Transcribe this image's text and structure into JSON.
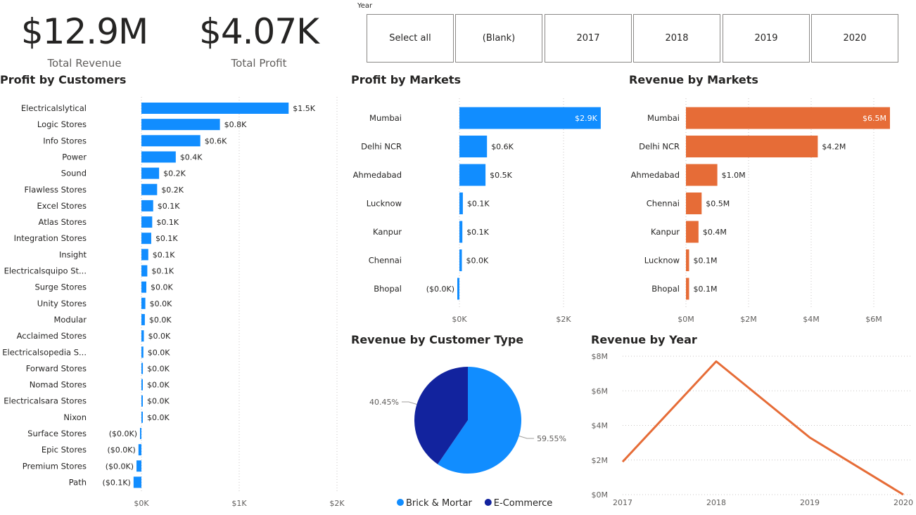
{
  "kpis": {
    "total_revenue": {
      "value": "$12.9M",
      "label": "Total Revenue"
    },
    "total_profit": {
      "value": "$4.07K",
      "label": "Total Profit"
    }
  },
  "slicer": {
    "label": "Year",
    "options": [
      "Select all",
      "(Blank)",
      "2017",
      "2018",
      "2019",
      "2020"
    ]
  },
  "titles": {
    "profit_customers": "Profit by Customers",
    "profit_markets": "Profit by Markets",
    "revenue_markets": "Revenue by Markets",
    "revenue_customer_type": "Revenue by Customer Type",
    "revenue_year": "Revenue by Year"
  },
  "colors": {
    "blue": "#118dff",
    "navy": "#12239e",
    "orange": "#e66c37",
    "grid": "#c8c6c4",
    "axis_text": "#605e5c"
  },
  "chart_data": [
    {
      "id": "profit_by_customers",
      "type": "bar",
      "orientation": "horizontal",
      "title": "Profit by Customers",
      "categories": [
        "Electricalslytical",
        "Logic Stores",
        "Info Stores",
        "Power",
        "Sound",
        "Flawless Stores",
        "Excel Stores",
        "Atlas Stores",
        "Integration Stores",
        "Insight",
        "Electricalsquipo St...",
        "Surge Stores",
        "Unity Stores",
        "Modular",
        "Acclaimed Stores",
        "Electricalsopedia S...",
        "Forward Stores",
        "Nomad Stores",
        "Electricalsara Stores",
        "Nixon",
        "Surface Stores",
        "Epic Stores",
        "Premium Stores",
        "Path"
      ],
      "values": [
        1500,
        800,
        600,
        350,
        180,
        160,
        120,
        110,
        100,
        70,
        60,
        50,
        40,
        35,
        25,
        20,
        15,
        10,
        8,
        5,
        -10,
        -30,
        -50,
        -80
      ],
      "data_labels": [
        "$1.5K",
        "$0.8K",
        "$0.6K",
        "$0.4K",
        "$0.2K",
        "$0.2K",
        "$0.1K",
        "$0.1K",
        "$0.1K",
        "$0.1K",
        "$0.1K",
        "$0.0K",
        "$0.0K",
        "$0.0K",
        "$0.0K",
        "$0.0K",
        "$0.0K",
        "$0.0K",
        "$0.0K",
        "$0.0K",
        "($0.0K)",
        "($0.0K)",
        "($0.0K)",
        "($0.1K)"
      ],
      "xlim": [
        0,
        2000
      ],
      "xticks": [
        "$0K",
        "$1K",
        "$2K"
      ],
      "color": "#118dff"
    },
    {
      "id": "profit_by_markets",
      "type": "bar",
      "orientation": "horizontal",
      "title": "Profit by Markets",
      "categories": [
        "Mumbai",
        "Delhi NCR",
        "Ahmedabad",
        "Lucknow",
        "Kanpur",
        "Chennai",
        "Bhopal"
      ],
      "values": [
        2870,
        560,
        530,
        70,
        60,
        50,
        -20
      ],
      "data_labels": [
        "$2.9K",
        "$0.6K",
        "$0.5K",
        "$0.1K",
        "$0.1K",
        "$0.0K",
        "($0.0K)"
      ],
      "xlim": [
        0,
        3000
      ],
      "xticks": [
        "$0K",
        "$2K"
      ],
      "color": "#118dff"
    },
    {
      "id": "revenue_by_markets",
      "type": "bar",
      "orientation": "horizontal",
      "title": "Revenue by Markets",
      "categories": [
        "Mumbai",
        "Delhi NCR",
        "Ahmedabad",
        "Chennai",
        "Kanpur",
        "Lucknow",
        "Bhopal"
      ],
      "values": [
        6.5,
        4.2,
        1.0,
        0.5,
        0.4,
        0.1,
        0.1
      ],
      "data_labels": [
        "$6.5M",
        "$4.2M",
        "$1.0M",
        "$0.5M",
        "$0.4M",
        "$0.1M",
        "$0.1M"
      ],
      "xlim": [
        0,
        6.5
      ],
      "xticks": [
        "$0M",
        "$2M",
        "$4M",
        "$6M"
      ],
      "color": "#e66c37"
    },
    {
      "id": "revenue_by_customer_type",
      "type": "pie",
      "title": "Revenue by Customer Type",
      "labels": [
        "Brick & Mortar",
        "E-Commerce"
      ],
      "values": [
        59.55,
        40.45
      ],
      "data_labels": [
        "59.55%",
        "40.45%"
      ],
      "colors": [
        "#118dff",
        "#12239e"
      ],
      "legend": "bottom"
    },
    {
      "id": "revenue_by_year",
      "type": "line",
      "title": "Revenue by Year",
      "x": [
        "2017",
        "2018",
        "2019",
        "2020"
      ],
      "values": [
        1.9,
        7.7,
        3.3,
        0.0
      ],
      "ylim": [
        0,
        8
      ],
      "yticks": [
        "$0M",
        "$2M",
        "$4M",
        "$6M",
        "$8M"
      ],
      "grid": true,
      "color": "#e66c37"
    }
  ]
}
